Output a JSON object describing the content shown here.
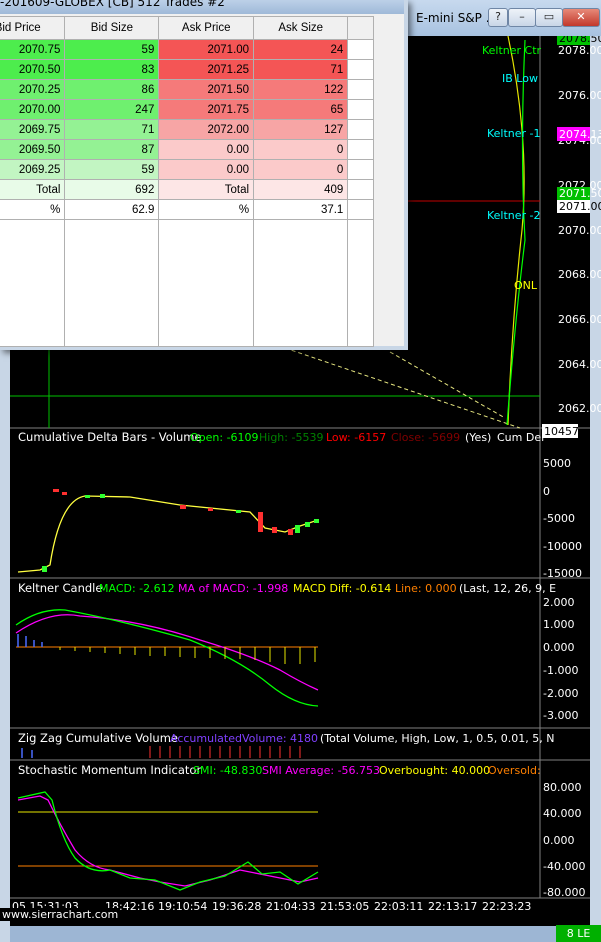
{
  "dom_window": {
    "title": "-201609-GLOBEX [CB]  512 Trades  #2",
    "headers": [
      "Bid Price",
      "Bid Size",
      "Ask Price",
      "Ask Size"
    ],
    "rows": [
      {
        "bid_price": "2070.75",
        "bid_size": "59",
        "ask_price": "2071.00",
        "ask_size": "24"
      },
      {
        "bid_price": "2070.50",
        "bid_size": "83",
        "ask_price": "2071.25",
        "ask_size": "71"
      },
      {
        "bid_price": "2070.25",
        "bid_size": "86",
        "ask_price": "2071.50",
        "ask_size": "122"
      },
      {
        "bid_price": "2070.00",
        "bid_size": "247",
        "ask_price": "2071.75",
        "ask_size": "65"
      },
      {
        "bid_price": "2069.75",
        "bid_size": "71",
        "ask_price": "2072.00",
        "ask_size": "127"
      },
      {
        "bid_price": "2069.50",
        "bid_size": "87",
        "ask_price": "0.00",
        "ask_size": "0"
      },
      {
        "bid_price": "2069.25",
        "bid_size": "59",
        "ask_price": "0.00",
        "ask_size": "0"
      }
    ],
    "total_row": {
      "bid_label": "Total",
      "bid_value": "692",
      "ask_label": "Total",
      "ask_value": "409"
    },
    "pct_row": {
      "bid_label": "%",
      "bid_value": "62.9",
      "ask_label": "%",
      "ask_value": "37.1"
    }
  },
  "chart_window": {
    "title": "E-mini S&P ...",
    "buttons": {
      "help": "?",
      "minimize": "–",
      "restore": "▭",
      "close": "✕"
    }
  },
  "price_panel": {
    "axis_labels": [
      "2078.00",
      "2076.00",
      "2074.00",
      "2072.00",
      "2070.00",
      "2068.00",
      "2066.00",
      "2064.00",
      "2062.00"
    ],
    "price_tags": {
      "top": "2078.50",
      "magenta": "2074.13",
      "green": "2071.50",
      "white": "2071.00"
    },
    "line_labels": {
      "keltner_ctr": "Keltner Ctr",
      "ib_low": "IB Low",
      "keltner_1": "Keltner -1",
      "keltner_2": "Keltner -2",
      "onl": "ONL"
    },
    "colors": {
      "keltner": "#ffff00",
      "ib_low": "#00ffff",
      "keltner_ctr": "#00ff00",
      "onl": "#ffff00"
    }
  },
  "delta_panel": {
    "title": "Cumulative Delta Bars - Volume",
    "open": "Open: -6109",
    "high": "High: -5539",
    "low": "Low: -6157",
    "close": "Close: -5699",
    "yes": "(Yes)",
    "cum": "Cum Del",
    "top_tag": "10457",
    "axis_labels": [
      "5000",
      "0",
      "-5000",
      "-10000",
      "-15000"
    ]
  },
  "macd_panel": {
    "title": "Keltner Candle",
    "macd": "MACD: -2.612",
    "ma": "MA of MACD: -1.998",
    "diff": "MACD Diff: -0.614",
    "line": "Line: 0.000",
    "params": "(Last, 12, 26, 9, E",
    "axis_labels": [
      "2.000",
      "1.000",
      "0.000",
      "-1.000",
      "-2.000",
      "-3.000"
    ]
  },
  "zigzag_panel": {
    "title": "Zig Zag Cumulative Volume",
    "acc": "AccumulatedVolume: 4180",
    "params": "(Total Volume, High, Low, 1, 0.5, 0.01, 5, N"
  },
  "smi_panel": {
    "title": "Stochastic Momentum Indicator",
    "smi": "SMI: -48.830",
    "avg": "SMI Average: -56.753",
    "ob": "Overbought: 40.000",
    "os": "Oversold:",
    "axis_labels": [
      "80.000",
      "40.000",
      "0.000",
      "-40.000",
      "-80.000"
    ]
  },
  "time_axis": [
    "05 15:31:03",
    "18:42:16",
    "19:10:54",
    "19:36:28",
    "21:04:33",
    "21:53:05",
    "22:03:11",
    "22:13:17",
    "22:23:23"
  ],
  "footer": {
    "site": "www.sierrachart.com",
    "badge": "8 LE"
  }
}
